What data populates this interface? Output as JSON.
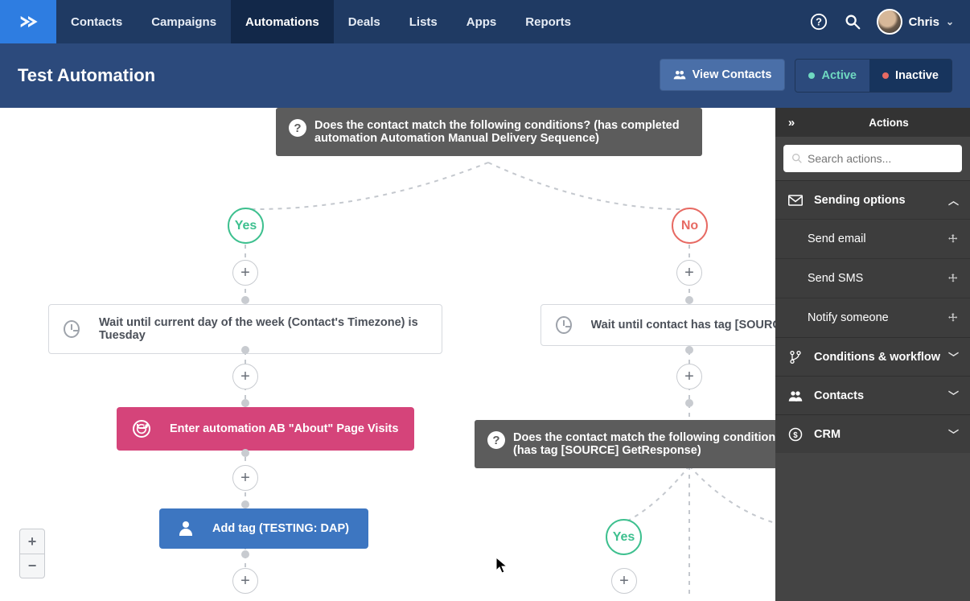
{
  "nav": {
    "items": [
      {
        "label": "Contacts"
      },
      {
        "label": "Campaigns"
      },
      {
        "label": "Automations",
        "active": true
      },
      {
        "label": "Deals"
      },
      {
        "label": "Lists"
      },
      {
        "label": "Apps"
      },
      {
        "label": "Reports"
      }
    ],
    "user_name": "Chris"
  },
  "header": {
    "title": "Test Automation",
    "view_contacts": "View Contacts",
    "active_label": "Active",
    "inactive_label": "Inactive"
  },
  "panel": {
    "title": "Actions",
    "search_placeholder": "Search actions...",
    "categories": [
      {
        "name": "Sending options",
        "icon": "mail",
        "open": true,
        "items": [
          "Send email",
          "Send SMS",
          "Notify someone"
        ]
      },
      {
        "name": "Conditions & workflow",
        "icon": "branch",
        "open": false
      },
      {
        "name": "Contacts",
        "icon": "people",
        "open": false
      },
      {
        "name": "CRM",
        "icon": "dollar",
        "open": false
      }
    ]
  },
  "flow": {
    "cond1": "Does the contact match the following conditions? (has completed automation Automation Manual Delivery Sequence)",
    "yes": "Yes",
    "no": "No",
    "wait_left": "Wait until current day of the week (Contact's Timezone) is Tuesday",
    "wait_right": "Wait until contact has tag [SOURCE] GetResponse",
    "enter": "Enter automation AB \"About\" Page Visits",
    "tag": "Add tag (TESTING: DAP)",
    "cond2": "Does the contact match the following conditions? (has tag [SOURCE] GetResponse)",
    "yes2": "Yes"
  },
  "zoom": {
    "in": "+",
    "out": "−"
  }
}
